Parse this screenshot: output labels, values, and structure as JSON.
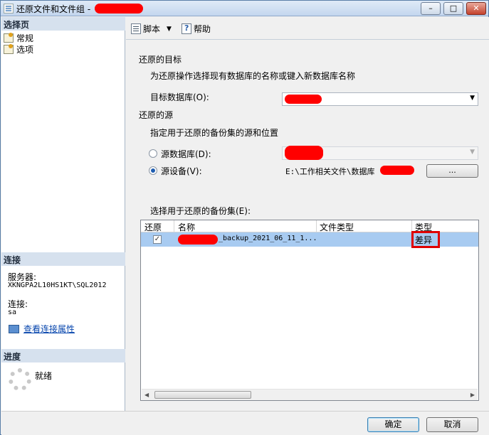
{
  "window": {
    "title": "还原文件和文件组 -",
    "minimize_glyph": "–",
    "maximize_glyph": "□",
    "close_glyph": "✕"
  },
  "left": {
    "select_page_title": "选择页",
    "pages": [
      {
        "label": "常规",
        "icon": "page-icon"
      },
      {
        "label": "选项",
        "icon": "page-icon"
      }
    ],
    "connection_title": "连接",
    "server_label": "服务器:",
    "server_value": "XKNGPA2L10HS1KT\\SQL2012",
    "connection_label": "连接:",
    "connection_value": "sa",
    "view_properties_link": "查看连接属性",
    "progress_title": "进度",
    "progress_status": "就绪"
  },
  "toolbar": {
    "script_label": "脚本",
    "help_label": "帮助"
  },
  "form": {
    "destination_heading": "还原的目标",
    "destination_hint": "为还原操作选择现有数据库的名称或键入新数据库名称",
    "target_db_label": "目标数据库(O):",
    "source_heading": "还原的源",
    "source_hint": "指定用于还原的备份集的源和位置",
    "source_db_label": "源数据库(D):",
    "source_device_label": "源设备(V):",
    "source_device_value": "E:\\工作相关文件\\数据库",
    "browse_button": "...",
    "backup_sets_label": "选择用于还原的备份集(E):",
    "selected_source": "device"
  },
  "grid": {
    "columns": [
      "还原",
      "名称",
      "文件类型",
      "类型"
    ],
    "rows": [
      {
        "restore": true,
        "name_suffix": "_backup_2021_06_11_1...",
        "file_type": "",
        "type": "差异"
      }
    ],
    "checkmark": "✓"
  },
  "footer": {
    "ok_label": "确定",
    "cancel_label": "取消"
  },
  "colors": {
    "highlight": "#e00000",
    "selection": "#a8cbf1",
    "section_header": "#d6e1ee"
  }
}
